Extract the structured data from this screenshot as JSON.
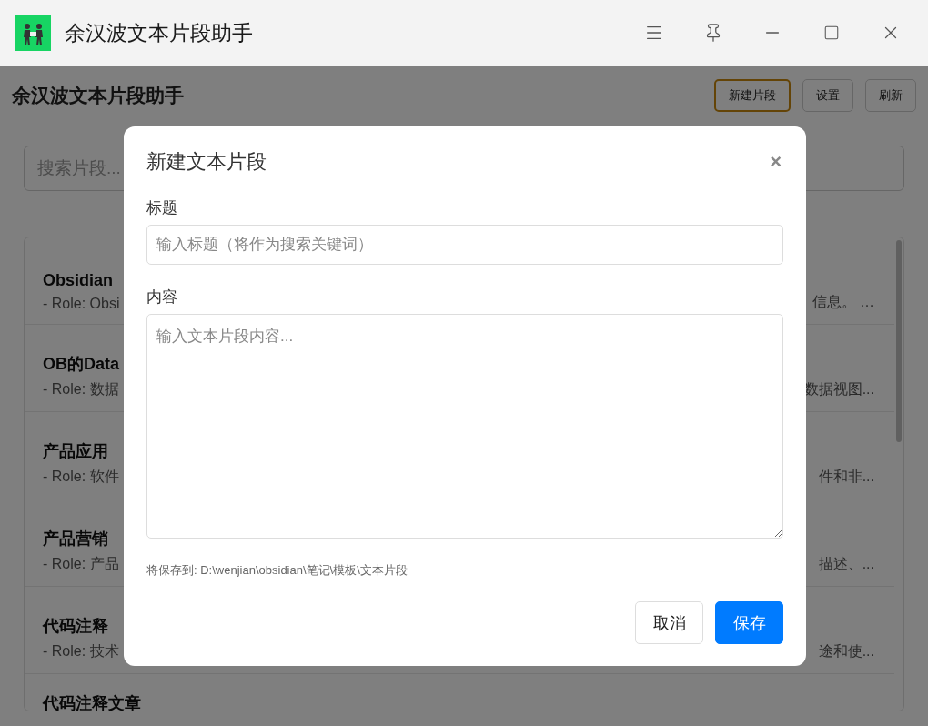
{
  "window": {
    "title": "余汉波文本片段助手"
  },
  "header": {
    "title": "余汉波文本片段助手",
    "buttons": [
      {
        "label": "新建片段",
        "focused": true
      },
      {
        "label": "设置",
        "focused": false
      },
      {
        "label": "刷新",
        "focused": false
      }
    ]
  },
  "search": {
    "placeholder": "搜索片段..."
  },
  "snippets": [
    {
      "title": "Obsidian",
      "description": "- Role: Obsi",
      "description_end": "信息。 …"
    },
    {
      "title": "OB的Data",
      "description": "- Role: 数据",
      "description_end": "数据视图..."
    },
    {
      "title": "产品应用",
      "description": "- Role: 软件",
      "description_end": "件和非..."
    },
    {
      "title": "产品营销",
      "description": "- Role: 产品",
      "description_end": "描述、..."
    },
    {
      "title": "代码注释",
      "description": "- Role: 技术",
      "description_end": "途和使..."
    },
    {
      "title": "代码注释文章"
    }
  ],
  "dialog": {
    "title": "新建文本片段",
    "close": "×",
    "fields": [
      {
        "label": "标题",
        "placeholder": "输入标题（将作为搜索关键词）",
        "kind": "input"
      },
      {
        "label": "内容",
        "placeholder": "输入文本片段内容...",
        "kind": "textarea"
      }
    ],
    "save_path": "将保存到: D:\\wenjian\\obsidian\\笔记\\模板\\文本片段",
    "buttons": [
      {
        "label": "取消",
        "primary": false
      },
      {
        "label": "保存",
        "primary": true
      }
    ]
  }
}
